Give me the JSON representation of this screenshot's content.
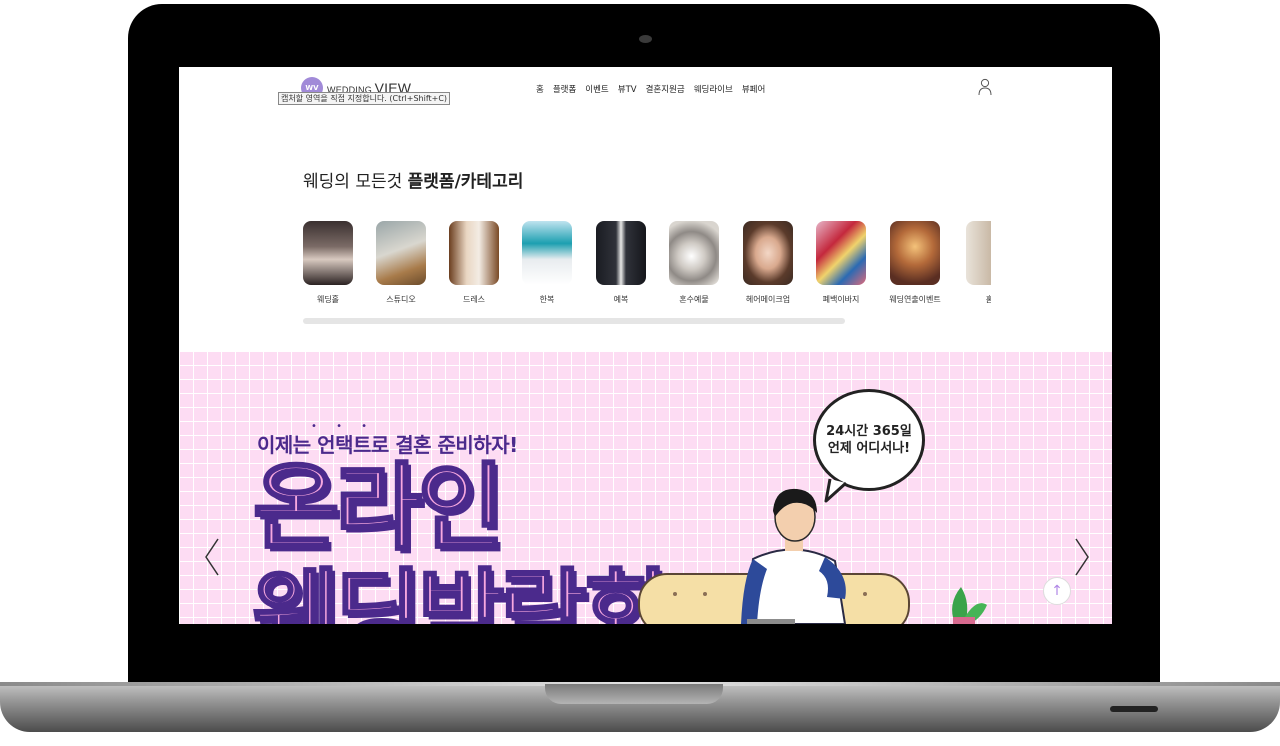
{
  "header": {
    "logo_mark": "WV",
    "logo_prefix": "WEDDING",
    "logo_main": "VIEW",
    "tooltip": "캡처할 영역을 직접 지정합니다. (Ctrl+Shift+C)",
    "nav": [
      "홈",
      "플랫폼",
      "이벤트",
      "뷰TV",
      "결혼지원금",
      "웨딩라이브",
      "뷰페어"
    ]
  },
  "platform": {
    "title_prefix": "웨딩의 모든것 ",
    "title_bold": "플랫폼/카테고리",
    "categories": [
      {
        "label": "웨딩홀",
        "icon": "wedding-hall-photo"
      },
      {
        "label": "스튜디오",
        "icon": "studio-photo"
      },
      {
        "label": "드레스",
        "icon": "dress-photo"
      },
      {
        "label": "한복",
        "icon": "hanbok-photo"
      },
      {
        "label": "예복",
        "icon": "suit-photo"
      },
      {
        "label": "혼수예물",
        "icon": "rings-photo"
      },
      {
        "label": "헤어메이크업",
        "icon": "makeup-photo"
      },
      {
        "label": "폐백이바지",
        "icon": "pyebaek-photo"
      },
      {
        "label": "웨딩연출이벤트",
        "icon": "event-photo"
      },
      {
        "label": "홈[",
        "icon": "home-photo"
      }
    ]
  },
  "banner": {
    "subtitle": "이제는 언택트로 결혼 준비하자!",
    "title_line1": "온라인",
    "title_line2": "웨딩박람회",
    "bubble_line1": "24시간 365일",
    "bubble_line2": "언제 어디서나!",
    "top_button": "↑"
  },
  "colors": {
    "banner_bg": "#fddcf3",
    "banner_title": "#f7a8df",
    "banner_outline": "#4b2a8c",
    "logo_mark": "#a18ad8"
  }
}
